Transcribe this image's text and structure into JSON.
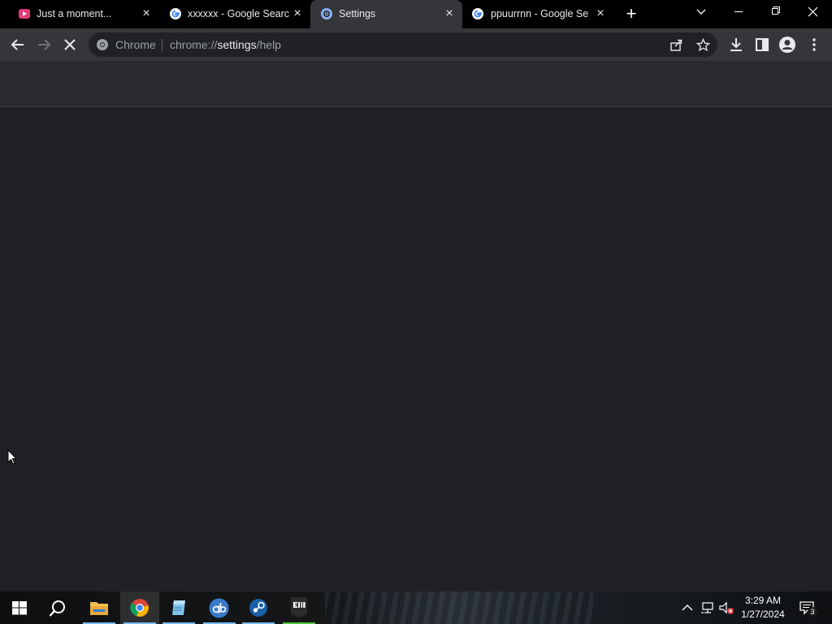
{
  "tabs": [
    {
      "title": "Just a moment...",
      "favicon": "media-site-icon",
      "active": false
    },
    {
      "title": "xxxxxx - Google Search",
      "favicon": "google-icon",
      "active": false
    },
    {
      "title": "Settings",
      "favicon": "settings-gear-icon",
      "active": true
    },
    {
      "title": "ppuurrnn - Google Sea",
      "favicon": "google-icon",
      "active": false
    }
  ],
  "toolbar": {
    "site_chip": "Chrome",
    "url_prefix": "chrome://",
    "url_host": "settings",
    "url_path": "/help"
  },
  "taskbar": {
    "apps": [
      {
        "name": "file-explorer"
      },
      {
        "name": "chrome"
      },
      {
        "name": "notepad-app"
      },
      {
        "name": "qbittorrent"
      },
      {
        "name": "steam"
      },
      {
        "name": "epic-games"
      }
    ],
    "time": "3:29 AM",
    "date": "1/27/2024",
    "notifications": "3"
  },
  "colors": {
    "tabstrip": "#000000",
    "toolbar": "#35363a",
    "page": "#202124",
    "accent": "#8ab4f8"
  }
}
